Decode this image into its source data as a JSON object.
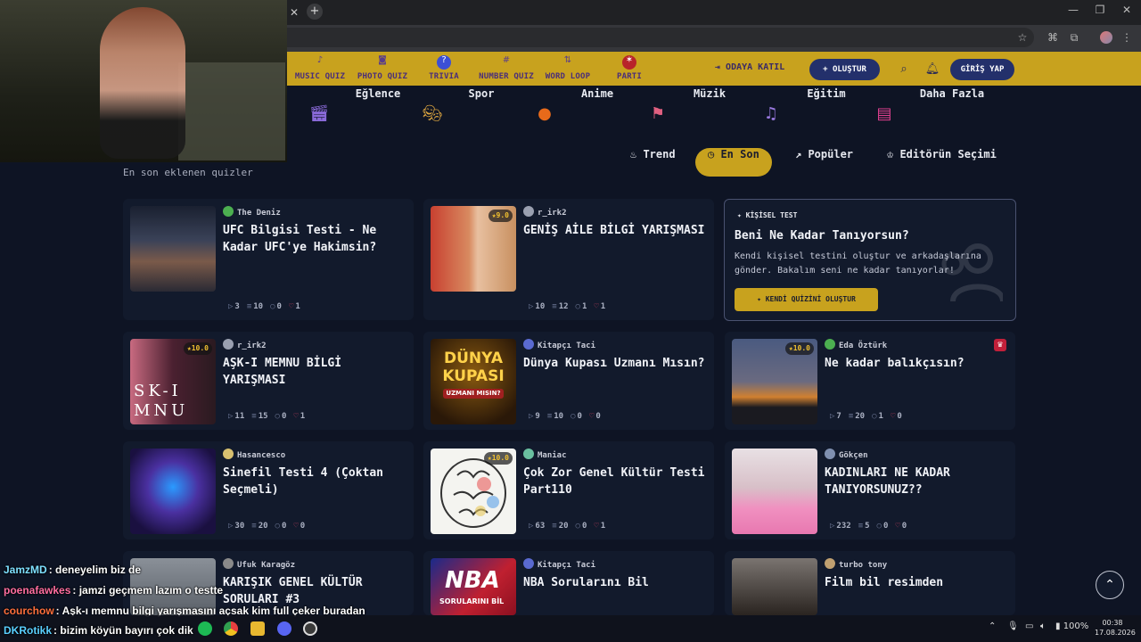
{
  "site_nav": {
    "items": [
      {
        "label": "MUSIC QUIZ",
        "icon": "music-note-icon"
      },
      {
        "label": "PHOTO QUIZ",
        "icon": "camera-icon"
      },
      {
        "label": "TRIVIA",
        "icon": "question-bubble-icon"
      },
      {
        "label": "NUMBER QUIZ",
        "icon": "hash-icon"
      },
      {
        "label": "WORD LOOP",
        "icon": "arrows-icon"
      },
      {
        "label": "PARTI",
        "icon": "party-icon"
      }
    ],
    "join": "ODAYA KATIL",
    "create": "+ OLUŞTUR",
    "login": "GİRİŞ YAP"
  },
  "categories": [
    {
      "label": "Eğlence",
      "icon": "clapperboard-icon"
    },
    {
      "label": "Spor",
      "icon": "theater-masks-icon"
    },
    {
      "label": "Anime",
      "icon": "basketball-icon"
    },
    {
      "label": "Müzik",
      "icon": "flags-icon"
    },
    {
      "label": "Eğitim",
      "icon": "music-notes-icon"
    },
    {
      "label": "Daha Fazla",
      "icon": "books-icon"
    }
  ],
  "section_label": "En son eklenen quizler",
  "filters": [
    {
      "label": "Trend",
      "active": false
    },
    {
      "label": "En Son",
      "active": true
    },
    {
      "label": "Popüler",
      "active": false
    },
    {
      "label": "Editörün Seçimi",
      "active": false
    }
  ],
  "quizzes": [
    {
      "author": "The Deniz",
      "title": "UFC Bilgisi Testi - Ne Kadar UFC'ye Hakimsin?",
      "rating": "",
      "stats": [
        "3",
        "10",
        "0",
        "1"
      ]
    },
    {
      "author": "r_irk2",
      "title": "GENİŞ AİLE BİLGİ YARIŞMASI",
      "rating": "9.0",
      "stats": [
        "10",
        "12",
        "1",
        "1"
      ]
    },
    {
      "author": "r_irk2",
      "title": "AŞK-I MEMNU BİLGİ YARIŞMASI",
      "rating": "10.0",
      "stats": [
        "11",
        "15",
        "0",
        "1"
      ]
    },
    {
      "author": "Kitapçı Taci",
      "title": "Dünya Kupası Uzmanı Mısın?",
      "rating": "",
      "stats": [
        "9",
        "10",
        "0",
        "0"
      ]
    },
    {
      "author": "Eda Öztürk",
      "title": "Ne kadar balıkçısın?",
      "rating": "10.0",
      "stats": [
        "7",
        "20",
        "1",
        "0"
      ]
    },
    {
      "author": "Hasancesco",
      "title": "Sinefil Testi 4 (Çoktan Seçmeli)",
      "rating": "",
      "stats": [
        "30",
        "20",
        "0",
        "0"
      ]
    },
    {
      "author": "Maniac",
      "title": "Çok Zor Genel Kültür Testi Part110",
      "rating": "10.0",
      "stats": [
        "63",
        "20",
        "0",
        "1"
      ]
    },
    {
      "author": "Gökçen",
      "title": "KADINLARI NE KADAR TANIYORSUNUZ??",
      "rating": "",
      "stats": [
        "232",
        "5",
        "0",
        "0"
      ]
    },
    {
      "author": "Ufuk Karagöz",
      "title": "KARIŞIK GENEL KÜLTÜR SORULARI #3",
      "rating": "",
      "stats": []
    },
    {
      "author": "Kitapçı Taci",
      "title": "NBA Sorularını Bil",
      "rating": "",
      "stats": []
    },
    {
      "author": "turbo tony",
      "title": "Film bil resimden",
      "rating": "",
      "stats": []
    }
  ],
  "thumb_text": {
    "ask": "SK-I MNU",
    "dunya": "DÜNYA KUPASI",
    "uzmani": "UZMANI MISIN?",
    "nba": "NBA",
    "nba_sub": "SORULARINI BİL"
  },
  "promo": {
    "tag": "KİŞİSEL TEST",
    "title": "Beni Ne Kadar Tanıyorsun?",
    "desc": "Kendi kişisel testini oluştur ve arkadaşlarına gönder. Bakalım seni ne kadar tanıyorlar!",
    "button": "KENDİ QUİZİNİ OLUŞTUR"
  },
  "chat": [
    {
      "user": "JamzMD",
      "msg": "deneyelim biz de",
      "color": "#7ee0ff"
    },
    {
      "user": "poenafawkes",
      "msg": "jamzi geçmem lazım o testte",
      "color": "#ff6ea0"
    },
    {
      "user": "courchow",
      "msg": "Aşk-ı memnu bilgi yarışmasını açsak kim full çeker buradan",
      "color": "#ff6f3c"
    },
    {
      "user": "DKRotikk",
      "msg": "bizim köyün bayırı çok dik",
      "color": "#5ad0ff"
    }
  ],
  "taskbar": {
    "battery": "100%",
    "time": "00:38",
    "date": "17.08.2026"
  },
  "colors": {
    "accent": "#c8a21e",
    "background": "#0e1424",
    "card": "#121a2c",
    "nav_button": "#23306b"
  }
}
